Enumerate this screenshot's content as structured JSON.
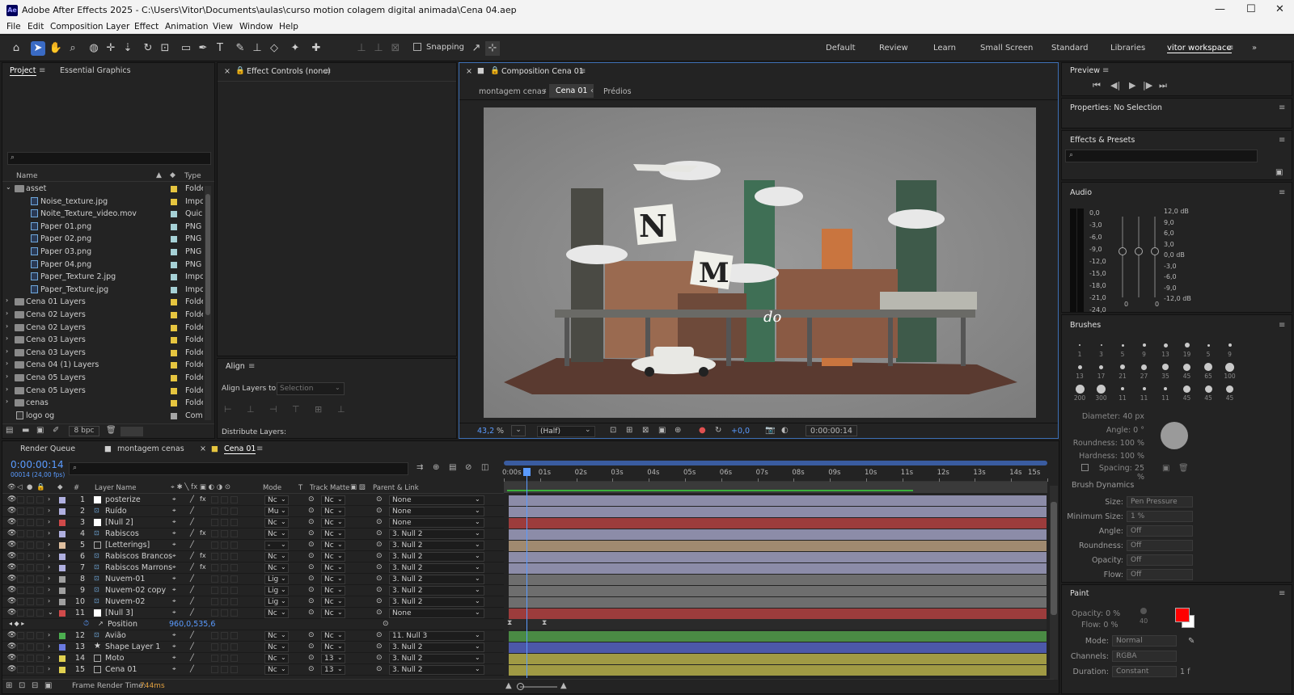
{
  "app": {
    "title": "Adobe After Effects 2025 - C:\\Users\\Vitor\\Documents\\aulas\\curso motion colagem digital animada\\Cena 04.aep",
    "logo": "Ae"
  },
  "menu": [
    "File",
    "Edit",
    "Composition",
    "Layer",
    "Effect",
    "Animation",
    "View",
    "Window",
    "Help"
  ],
  "toolbar": {
    "snapping": "Snapping",
    "workspaces": [
      "Default",
      "Review",
      "Learn",
      "Small Screen",
      "Standard",
      "Libraries"
    ],
    "active_workspace": "vitor workspace"
  },
  "project": {
    "tab_project": "Project",
    "tab_essential": "Essential Graphics",
    "col_name": "Name",
    "col_type": "Type",
    "items": [
      {
        "name": "asset",
        "type": "Folde",
        "kind": "folder",
        "open": true,
        "color": "#e6c53f",
        "indent": 0
      },
      {
        "name": "Noise_texture.jpg",
        "type": "Impo",
        "kind": "file",
        "color": "#e6c53f",
        "indent": 1
      },
      {
        "name": "Noite_Texture_video.mov",
        "type": "Quick",
        "kind": "file",
        "color": "#a6d1d6",
        "indent": 1
      },
      {
        "name": "Paper 01.png",
        "type": "PNG f",
        "kind": "file",
        "color": "#a6d1d6",
        "indent": 1
      },
      {
        "name": "Paper 02.png",
        "type": "PNG f",
        "kind": "file",
        "color": "#a6d1d6",
        "indent": 1
      },
      {
        "name": "Paper 03.png",
        "type": "PNG f",
        "kind": "file",
        "color": "#a6d1d6",
        "indent": 1
      },
      {
        "name": "Paper 04.png",
        "type": "PNG f",
        "kind": "file",
        "color": "#a6d1d6",
        "indent": 1
      },
      {
        "name": "Paper_Texture 2.jpg",
        "type": "Impo",
        "kind": "file",
        "color": "#a6d1d6",
        "indent": 1
      },
      {
        "name": "Paper_Texture.jpg",
        "type": "Impo",
        "kind": "file",
        "color": "#a6d1d6",
        "indent": 1
      },
      {
        "name": "Cena 01 Layers",
        "type": "Folde",
        "kind": "folder",
        "color": "#e6c53f",
        "indent": 0
      },
      {
        "name": "Cena 02 Layers",
        "type": "Folde",
        "kind": "folder",
        "color": "#e6c53f",
        "indent": 0
      },
      {
        "name": "Cena 02 Layers",
        "type": "Folde",
        "kind": "folder",
        "color": "#e6c53f",
        "indent": 0
      },
      {
        "name": "Cena 03 Layers",
        "type": "Folde",
        "kind": "folder",
        "color": "#e6c53f",
        "indent": 0
      },
      {
        "name": "Cena 03 Layers",
        "type": "Folde",
        "kind": "folder",
        "color": "#e6c53f",
        "indent": 0
      },
      {
        "name": "Cena 04 (1) Layers",
        "type": "Folde",
        "kind": "folder",
        "color": "#e6c53f",
        "indent": 0
      },
      {
        "name": "Cena 05 Layers",
        "type": "Folde",
        "kind": "folder",
        "color": "#e6c53f",
        "indent": 0
      },
      {
        "name": "Cena 05 Layers",
        "type": "Folde",
        "kind": "folder",
        "color": "#e6c53f",
        "indent": 0
      },
      {
        "name": "cenas",
        "type": "Folde",
        "kind": "folder",
        "color": "#e6c53f",
        "indent": 0
      },
      {
        "name": "logo og",
        "type": "Comp",
        "kind": "comp",
        "color": "#a6a6a6",
        "indent": 0
      }
    ],
    "bpc": "8 bpc"
  },
  "effect_controls": {
    "title": "Effect Controls (none)"
  },
  "align": {
    "title": "Align",
    "align_to": "Align Layers to:",
    "selection": "Selection",
    "distribute": "Distribute Layers:"
  },
  "composition": {
    "title": "Composition Cena 01",
    "breadcrumbs": [
      "montagem cenas",
      "Cena 01",
      "Prédios"
    ],
    "zoom": "43,2",
    "zoom_unit": "%",
    "resolution": "(Half)",
    "exposure": "+0,0",
    "timecode": "0:00:00:14"
  },
  "preview": {
    "title": "Preview"
  },
  "properties": {
    "title": "Properties: No Selection"
  },
  "effects_presets": {
    "title": "Effects & Presets"
  },
  "audio": {
    "title": "Audio",
    "left_scale": [
      "0,0",
      "-3,0",
      "-6,0",
      "-9,0",
      "-12,0",
      "-15,0",
      "-18,0",
      "-21,0",
      "-24,0"
    ],
    "right_scale": [
      "12,0 dB",
      "9,0",
      "6,0",
      "3,0",
      "0,0 dB",
      "-3,0",
      "-6,0",
      "-9,0",
      "-12,0 dB"
    ],
    "zero_left": "0",
    "zero_right": "0"
  },
  "brushes": {
    "title": "Brushes",
    "sizes": [
      "1",
      "3",
      "5",
      "9",
      "13",
      "19",
      "5",
      "9",
      "13",
      "17",
      "21",
      "27",
      "35",
      "45",
      "65",
      "100",
      "200",
      "300",
      "11",
      "11",
      "11",
      "45",
      "45",
      "45"
    ],
    "diameter": "Diameter: 40 px",
    "angle": "Angle: 0 °",
    "roundness": "Roundness: 100 %",
    "hardness": "Hardness: 100 %",
    "spacing": "Spacing: 25 %",
    "dynamics_title": "Brush Dynamics",
    "dyn": [
      {
        "label": "Size:",
        "value": "Pen Pressure"
      },
      {
        "label": "Minimum Size:",
        "value": "1 %"
      },
      {
        "label": "Angle:",
        "value": "Off"
      },
      {
        "label": "Roundness:",
        "value": "Off"
      },
      {
        "label": "Opacity:",
        "value": "Off"
      },
      {
        "label": "Flow:",
        "value": "Off"
      }
    ]
  },
  "paint": {
    "title": "Paint",
    "opacity": "Opacity: 0 %",
    "flow": "Flow: 0 %",
    "num": "40",
    "mode_label": "Mode:",
    "mode": "Normal",
    "channels_label": "Channels:",
    "channels": "RGBA",
    "duration_label": "Duration:",
    "duration": "Constant",
    "duration_extra": "1 f",
    "fg_color": "#ff0000",
    "bg_color": "#ffffff"
  },
  "timeline": {
    "tabs": [
      "Render Queue",
      "montagem cenas",
      "Cena 01"
    ],
    "timecode": "0:00:00:14",
    "fps": "00014 (24,00 fps)",
    "headers": {
      "layer_name": "Layer Name",
      "mode": "Mode",
      "t": "T",
      "track_matte": "Track Matte",
      "parent": "Parent & Link",
      "num": "#"
    },
    "ruler": [
      "0:00s",
      "01s",
      "02s",
      "03s",
      "04s",
      "05s",
      "06s",
      "07s",
      "08s",
      "09s",
      "10s",
      "11s",
      "12s",
      "13s",
      "14s",
      "15s"
    ],
    "layers": [
      {
        "num": "1",
        "name": "posterize",
        "label": "#b0b0e0",
        "mode": "Nc",
        "matte": "Nc",
        "parent": "None",
        "bar": "#8c8ca8",
        "fx": true,
        "icon": "solid"
      },
      {
        "num": "2",
        "name": "Ruído",
        "label": "#b0b0e0",
        "mode": "Mu",
        "matte": "Nc",
        "parent": "None",
        "bar": "#8c8ca8",
        "icon": "file"
      },
      {
        "num": "3",
        "name": "[Null 2]",
        "label": "#d04a4a",
        "mode": "Nc",
        "matte": "Nc",
        "parent": "None",
        "bar": "#9c3c3c",
        "icon": "solid"
      },
      {
        "num": "4",
        "name": "Rabiscos",
        "label": "#b0b0e0",
        "mode": "Nc",
        "matte": "Nc",
        "parent": "3. Null 2",
        "bar": "#8c8ca8",
        "fx": true,
        "icon": "file"
      },
      {
        "num": "5",
        "name": "[Letterings]",
        "label": "#e0c0a0",
        "mode": "-",
        "matte": "Nc",
        "parent": "3. Null 2",
        "bar": "#a08a70",
        "icon": "comp"
      },
      {
        "num": "6",
        "name": "Rabiscos Brancos",
        "label": "#b0b0e0",
        "mode": "Nc",
        "matte": "Nc",
        "parent": "3. Null 2",
        "bar": "#8c8ca8",
        "fx": true,
        "icon": "file"
      },
      {
        "num": "7",
        "name": "Rabiscos Marrons",
        "label": "#b0b0e0",
        "mode": "Nc",
        "matte": "Nc",
        "parent": "3. Null 2",
        "bar": "#8c8ca8",
        "fx": true,
        "icon": "file"
      },
      {
        "num": "8",
        "name": "Nuvem-01",
        "label": "#a0a0a0",
        "mode": "Lig",
        "matte": "Nc",
        "parent": "3. Null 2",
        "bar": "#6e6e6e",
        "icon": "file"
      },
      {
        "num": "9",
        "name": "Nuvem-02 copy",
        "label": "#a0a0a0",
        "mode": "Lig",
        "matte": "Nc",
        "parent": "3. Null 2",
        "bar": "#6e6e6e",
        "icon": "file"
      },
      {
        "num": "10",
        "name": "Nuvem-02",
        "label": "#a0a0a0",
        "mode": "Lig",
        "matte": "Nc",
        "parent": "3. Null 2",
        "bar": "#6e6e6e",
        "icon": "file"
      },
      {
        "num": "11",
        "name": "[Null 3]",
        "label": "#d04a4a",
        "mode": "Nc",
        "matte": "Nc",
        "parent": "None",
        "bar": "#9c3c3c",
        "icon": "solid",
        "open": true
      },
      {
        "num": "",
        "name": "Position",
        "label": "",
        "mode": "",
        "matte": "",
        "parent": "",
        "bar": "",
        "value": "960,0,535,6",
        "prop": true
      },
      {
        "num": "12",
        "name": "Avião",
        "label": "#4caf50",
        "mode": "Nc",
        "matte": "Nc",
        "parent": "11. Null 3",
        "bar": "#4a8a44",
        "icon": "file"
      },
      {
        "num": "13",
        "name": "Shape Layer 1",
        "label": "#6a7ae0",
        "mode": "Nc",
        "matte": "Nc",
        "parent": "3. Null 2",
        "bar": "#4c58a8",
        "icon": "shape"
      },
      {
        "num": "14",
        "name": "Moto",
        "label": "#e0d050",
        "mode": "Nc",
        "matte": "13",
        "parent": "3. Null 2",
        "bar": "#a09a44",
        "icon": "comp"
      },
      {
        "num": "15",
        "name": "Cena 01",
        "label": "#e0d050",
        "mode": "Nc",
        "matte": "13",
        "parent": "3. Null 2",
        "bar": "#a09a44",
        "icon": "comp"
      }
    ],
    "frame_render": "Frame Render Time:",
    "frame_render_value": "744ms"
  }
}
